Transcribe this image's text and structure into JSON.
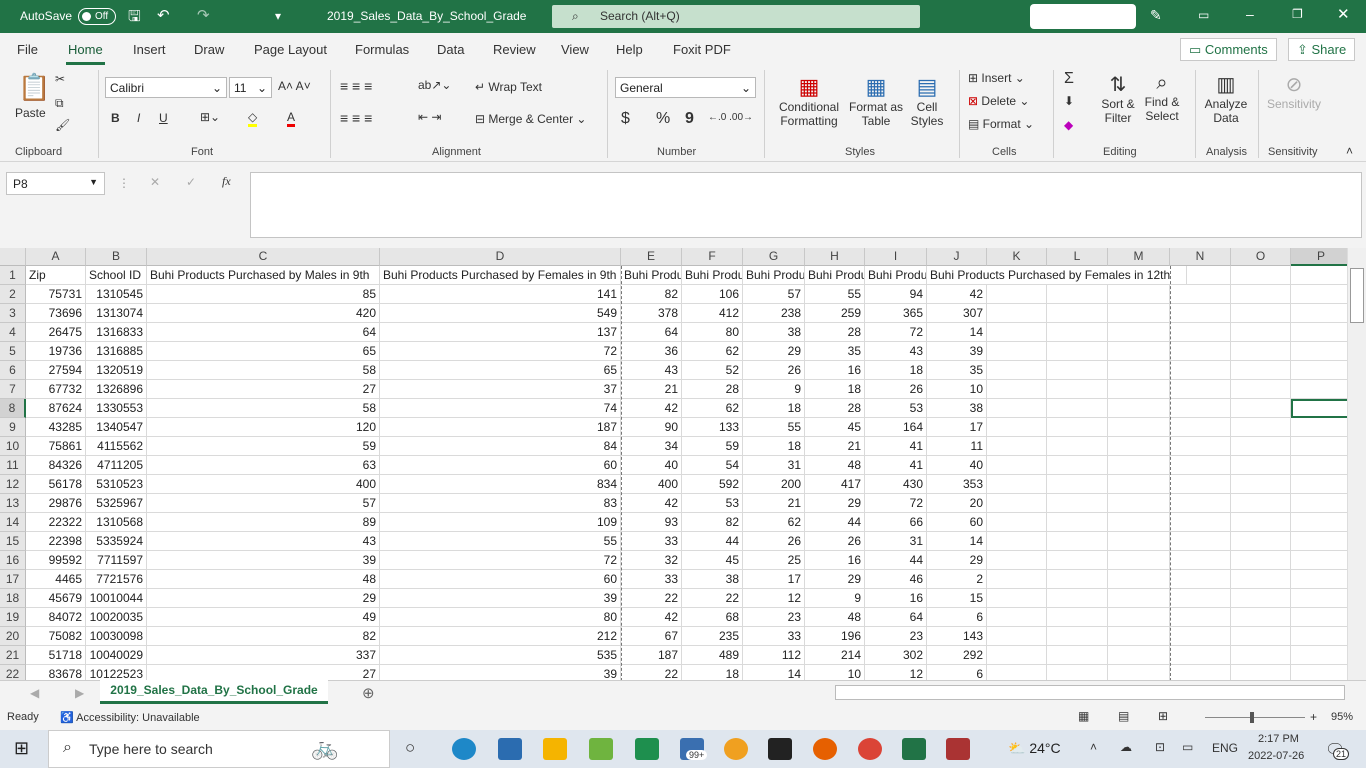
{
  "titlebar": {
    "autosave_label": "AutoSave",
    "autosave_state": "Off",
    "filename": "2019_Sales_Data_By_School_Grade",
    "search_placeholder": "Search (Alt+Q)",
    "accent": "#217346"
  },
  "menu": {
    "tabs": [
      "File",
      "Home",
      "Insert",
      "Draw",
      "Page Layout",
      "Formulas",
      "Data",
      "Review",
      "View",
      "Help",
      "Foxit PDF"
    ],
    "active": "Home",
    "comments": "Comments",
    "share": "Share"
  },
  "ribbon": {
    "clipboard": {
      "paste": "Paste",
      "group": "Clipboard"
    },
    "font": {
      "name": "Calibri",
      "size": "11",
      "group": "Font",
      "bold": "B",
      "italic": "I",
      "underline": "U"
    },
    "alignment": {
      "wrap": "Wrap Text",
      "merge": "Merge & Center",
      "group": "Alignment"
    },
    "number": {
      "format": "General",
      "currency": "$",
      "percent": "%",
      "comma": "9",
      "group": "Number"
    },
    "styles": {
      "conditional": "Conditional Formatting",
      "format_table": "Format as Table",
      "cell_styles": "Cell Styles",
      "group": "Styles"
    },
    "cells": {
      "insert": "Insert",
      "delete": "Delete",
      "format": "Format",
      "group": "Cells"
    },
    "editing": {
      "sort": "Sort & Filter",
      "find": "Find & Select",
      "group": "Editing"
    },
    "analysis": {
      "analyze": "Analyze Data",
      "group": "Analysis"
    },
    "sensitivity": {
      "label": "Sensitivity",
      "group": "Sensitivity"
    }
  },
  "formula_bar": {
    "name_box": "P8",
    "fx": "fx",
    "value": ""
  },
  "sheet": {
    "columns": [
      "A",
      "B",
      "C",
      "D",
      "E",
      "F",
      "G",
      "H",
      "I",
      "J",
      "K",
      "L",
      "M",
      "N",
      "O",
      "P"
    ],
    "selected_cell": "P8",
    "headers": [
      "Zip",
      "School ID",
      "Buhi Products Purchased by Males in 9th",
      "Buhi Products Purchased by Females in 9th",
      "Buhi Produ",
      "Buhi Produ",
      "Buhi Produ",
      "Buhi Produ",
      "Buhi Produ",
      "Buhi Products Purchased by Females in 12th"
    ],
    "rows": [
      [
        75731,
        1310545,
        85,
        141,
        82,
        106,
        57,
        55,
        94,
        42
      ],
      [
        73696,
        1313074,
        420,
        549,
        378,
        412,
        238,
        259,
        365,
        307
      ],
      [
        26475,
        1316833,
        64,
        137,
        64,
        80,
        38,
        28,
        72,
        14
      ],
      [
        19736,
        1316885,
        65,
        72,
        36,
        62,
        29,
        35,
        43,
        39
      ],
      [
        27594,
        1320519,
        58,
        65,
        43,
        52,
        26,
        16,
        18,
        35
      ],
      [
        67732,
        1326896,
        27,
        37,
        21,
        28,
        9,
        18,
        26,
        10
      ],
      [
        87624,
        1330553,
        58,
        74,
        42,
        62,
        18,
        28,
        53,
        38
      ],
      [
        43285,
        1340547,
        120,
        187,
        90,
        133,
        55,
        45,
        164,
        17
      ],
      [
        75861,
        4115562,
        59,
        84,
        34,
        59,
        18,
        21,
        41,
        11
      ],
      [
        84326,
        4711205,
        63,
        60,
        40,
        54,
        31,
        48,
        41,
        40
      ],
      [
        56178,
        5310523,
        400,
        834,
        400,
        592,
        200,
        417,
        430,
        353
      ],
      [
        29876,
        5325967,
        57,
        83,
        42,
        53,
        21,
        29,
        72,
        20
      ],
      [
        22322,
        1310568,
        89,
        109,
        93,
        82,
        62,
        44,
        66,
        60
      ],
      [
        22398,
        5335924,
        43,
        55,
        33,
        44,
        26,
        26,
        31,
        14
      ],
      [
        99592,
        7711597,
        39,
        72,
        32,
        45,
        25,
        16,
        44,
        29
      ],
      [
        4465,
        7721576,
        48,
        60,
        33,
        38,
        17,
        29,
        46,
        2
      ],
      [
        45679,
        10010044,
        29,
        39,
        22,
        22,
        12,
        9,
        16,
        15
      ],
      [
        84072,
        10020035,
        49,
        80,
        42,
        68,
        23,
        48,
        64,
        6
      ],
      [
        75082,
        10030098,
        82,
        212,
        67,
        235,
        33,
        196,
        23,
        143
      ],
      [
        51718,
        10040029,
        337,
        535,
        187,
        489,
        112,
        214,
        302,
        292
      ],
      [
        83678,
        10122523,
        27,
        39,
        22,
        18,
        14,
        10,
        12,
        6
      ]
    ]
  },
  "sheet_tabs": {
    "active": "2019_Sales_Data_By_School_Grade"
  },
  "status": {
    "ready": "Ready",
    "accessibility": "Accessibility: Unavailable",
    "zoom": "95%"
  },
  "taskbar": {
    "search_placeholder": "Type here to search",
    "weather": "24°C",
    "lang": "ENG",
    "time": "2:17 PM",
    "date": "2022-07-26",
    "mail_badge": "99+",
    "notifications": "21"
  }
}
